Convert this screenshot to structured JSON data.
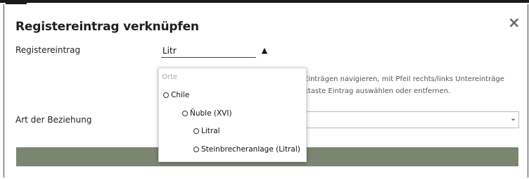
{
  "dialog": {
    "title": "Registereintrag verknüpfen",
    "close_symbol": "×"
  },
  "form": {
    "registry_label": "Registereintrag",
    "registry_value": "Litr",
    "dropdown_toggle_symbol": "▲",
    "help_line1": "Einträgen navigieren, mit Pfeil rechts/links Untereinträge",
    "help_line2": "xtaste Eintrag auswählen oder entfernen.",
    "relation_label": "Art der Beziehung",
    "relation_value": "",
    "relation_chevron": "⌄"
  },
  "dropdown": {
    "header": "Orte",
    "options": [
      {
        "label": "Chile",
        "level": 0
      },
      {
        "label": "Ñuble (XVI)",
        "level": 1
      },
      {
        "label": "Litral",
        "level": 2
      },
      {
        "label": "Steinbrecheranlage (Litral)",
        "level": 2
      }
    ]
  },
  "colors": {
    "accent_bar": "#7b8570",
    "input_underline": "#2e4a7a"
  },
  "icons": {
    "close": "close-icon",
    "toggle": "triangle-up-icon",
    "chevron": "chevron-down-icon",
    "radio": "radio-button-icon"
  }
}
